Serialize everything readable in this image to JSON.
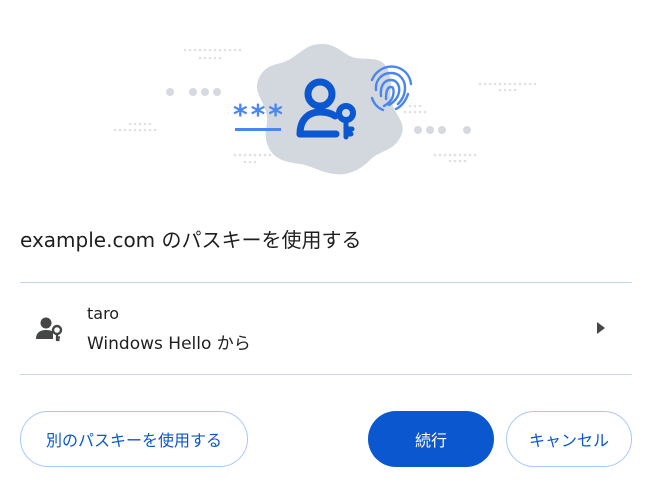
{
  "dialog": {
    "title": "example.com のパスキーを使用する"
  },
  "account": {
    "username": "taro",
    "source": "Windows Hello から",
    "icon": "person-key-icon"
  },
  "illustration": {
    "password_mask": "***",
    "icons": [
      "person-key-icon",
      "fingerprint-icon"
    ]
  },
  "buttons": {
    "use_other_passkey": "別のパスキーを使用する",
    "continue": "続行",
    "cancel": "キャンセル"
  },
  "colors": {
    "primary": "#0b57d0",
    "outline": "#a8c7fa",
    "divider": "#c4d7ef",
    "badge": "#d3d7de",
    "text": "#1f1f1f"
  }
}
